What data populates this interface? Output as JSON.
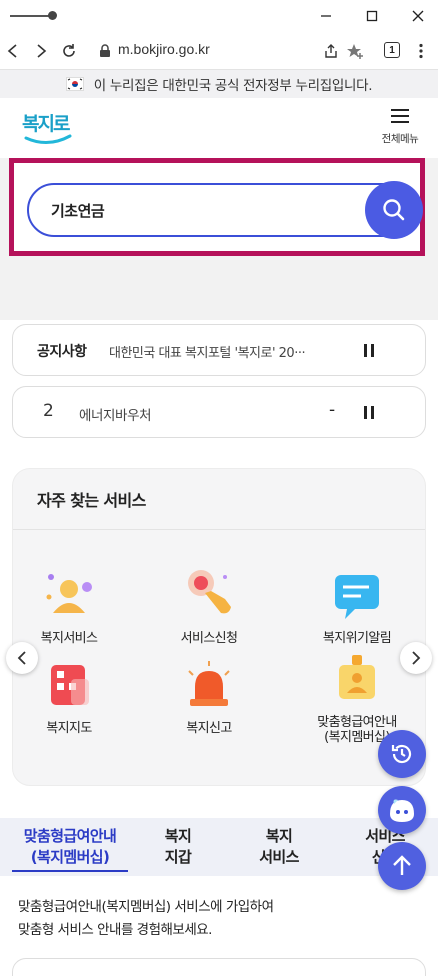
{
  "browser": {
    "url": "m.bokjiro.go.kr",
    "tab_count": "1"
  },
  "gov_banner": {
    "text": "이 누리집은 대한민국 공식 전자정부 누리집입니다."
  },
  "header": {
    "logo_text": "복지로",
    "menu_label": "전체메뉴"
  },
  "search": {
    "value": "기초연금"
  },
  "notice": {
    "title": "공지사항",
    "text": "대한민국 대표 복지포털 '복지로' 20···"
  },
  "popular_keyword": {
    "rank": "2",
    "text": "에너지바우처",
    "change": "-"
  },
  "frequent_services": {
    "title": "자주 찾는 서비스",
    "items": [
      {
        "label": "복지서비스",
        "icon": "person-icon"
      },
      {
        "label": "서비스신청",
        "icon": "hand-tap-icon"
      },
      {
        "label": "복지위기알림",
        "icon": "chat-alert-icon"
      },
      {
        "label": "복지지도",
        "icon": "map-icon"
      },
      {
        "label": "복지신고",
        "icon": "siren-icon"
      },
      {
        "label": "맞춤형급여안내\n(복지멤버십)",
        "icon": "membership-badge-icon"
      }
    ]
  },
  "tabs": [
    {
      "label": "맞춤형급여안내\n(복지멤버십)",
      "active": true
    },
    {
      "label": "복지\n지갑",
      "active": false
    },
    {
      "label": "복지\n서비스",
      "active": false
    },
    {
      "label": "서비스\n신청",
      "active": false
    }
  ],
  "membership_desc": "맞춤형급여안내(복지멤버십) 서비스에 가입하여\n맞춤형 서비스 안내를 경험해보세요.",
  "colors": {
    "accent": "#4b5be3",
    "highlight_frame": "#b5125a",
    "tab_active": "#2b3bc5"
  }
}
